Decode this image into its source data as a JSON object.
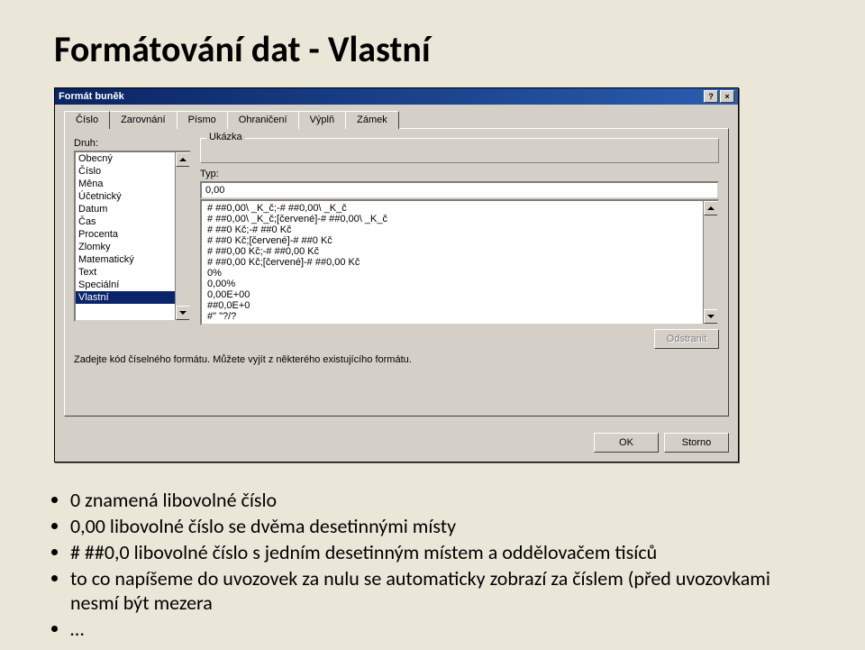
{
  "slide": {
    "title": "Formátování dat - Vlastní",
    "bullets": [
      "0 znamená libovolné číslo",
      "0,00 libovolné číslo se dvěma desetinnými místy",
      "# ##0,0 libovolné číslo s jedním desetinným místem a oddělovačem tisíců",
      "to co napíšeme do uvozovek za nulu se automaticky zobrazí za číslem (před uvozovkami nesmí být mezera",
      "…"
    ]
  },
  "dialog": {
    "title": "Formát buněk",
    "help_btn": "?",
    "close_btn": "×",
    "tabs": [
      "Číslo",
      "Zarovnání",
      "Písmo",
      "Ohraničení",
      "Výplň",
      "Zámek"
    ],
    "active_tab": 0,
    "druh_label": "Druh:",
    "categories": [
      "Obecný",
      "Číslo",
      "Měna",
      "Účetnický",
      "Datum",
      "Čas",
      "Procenta",
      "Zlomky",
      "Matematický",
      "Text",
      "Speciální",
      "Vlastní"
    ],
    "selected_category": 11,
    "sample_label": "Ukázka",
    "typ_label": "Typ:",
    "typ_value": "0,00",
    "formats": [
      "# ##0,00\\ _K_č;-# ##0,00\\ _K_č",
      "# ##0,00\\ _K_č;[červené]-# ##0,00\\ _K_č",
      "# ##0 Kč;-# ##0 Kč",
      "# ##0 Kč;[červené]-# ##0 Kč",
      "# ##0,00 Kč;-# ##0,00 Kč",
      "# ##0,00 Kč;[červené]-# ##0,00 Kč",
      "0%",
      "0,00%",
      "0,00E+00",
      "##0,0E+0",
      "#\" \"?/?"
    ],
    "delete_btn": "Odstranit",
    "hint": "Zadejte kód číselného formátu. Můžete vyjít z některého existujícího formátu.",
    "ok_btn": "OK",
    "cancel_btn": "Storno"
  }
}
